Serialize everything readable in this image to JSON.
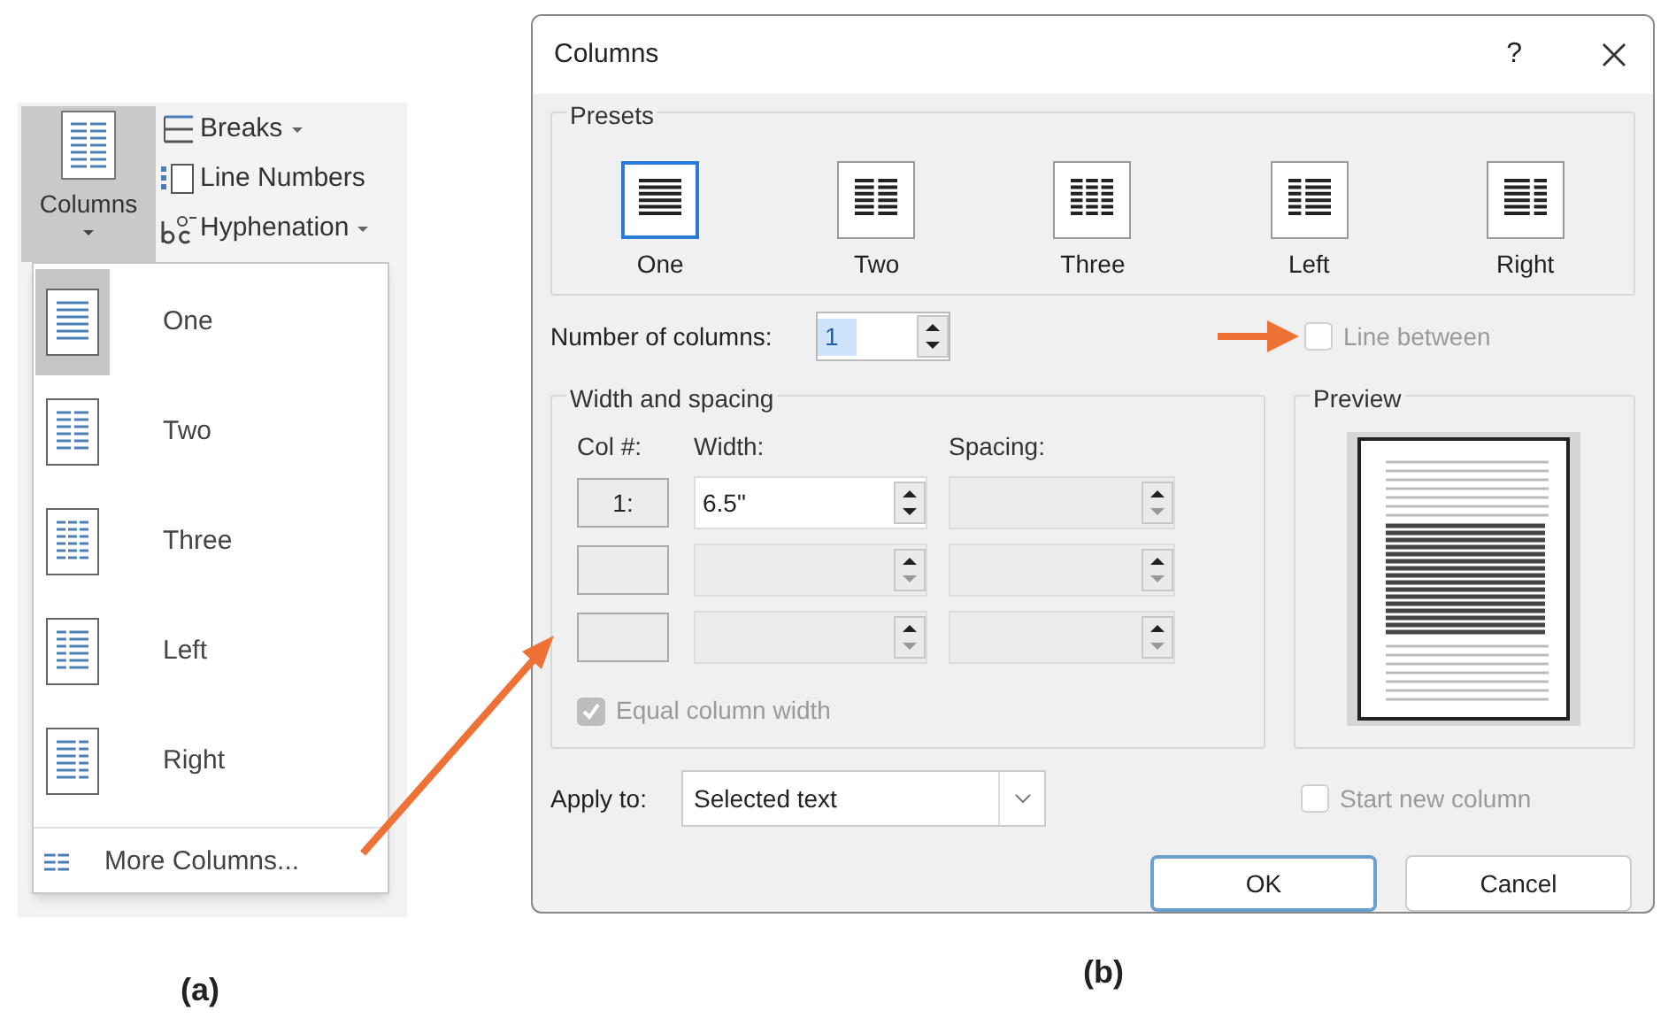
{
  "panel_a": {
    "ribbon": {
      "columns_button": "Columns",
      "commands": [
        {
          "label": "Breaks",
          "kind": "breaks",
          "dropdown": true
        },
        {
          "label": "Line Numbers",
          "kind": "line_numbers",
          "dropdown": false
        },
        {
          "label": "Hyphenation",
          "kind": "hyphenation",
          "dropdown": true
        }
      ]
    },
    "menu": {
      "items": [
        {
          "label": "One",
          "kind": "one",
          "selected": true
        },
        {
          "label": "Two",
          "kind": "two",
          "selected": false
        },
        {
          "label": "Three",
          "kind": "three",
          "selected": false
        },
        {
          "label": "Left",
          "kind": "left",
          "selected": false
        },
        {
          "label": "Right",
          "kind": "right",
          "selected": false
        }
      ],
      "more": "More Columns..."
    },
    "caption": "(a)"
  },
  "panel_b": {
    "dialog": {
      "title": "Columns",
      "help": "?",
      "presets": {
        "title": "Presets",
        "items": [
          {
            "label": "One",
            "kind": "one",
            "selected": true
          },
          {
            "label": "Two",
            "kind": "two",
            "selected": false
          },
          {
            "label": "Three",
            "kind": "three",
            "selected": false
          },
          {
            "label": "Left",
            "kind": "left",
            "selected": false
          },
          {
            "label": "Right",
            "kind": "right",
            "selected": false
          }
        ]
      },
      "number_of_columns": {
        "label": "Number of columns:",
        "value": "1"
      },
      "line_between": {
        "label": "Line between",
        "checked": false,
        "disabled": true
      },
      "width_and_spacing": {
        "title": "Width and spacing",
        "headers": [
          "Col #:",
          "Width:",
          "Spacing:"
        ],
        "rows": [
          {
            "col": "1:",
            "width": "6.5\"",
            "disabled": false
          },
          {
            "disabled": true
          },
          {
            "disabled": true
          }
        ]
      },
      "equal_column_width": {
        "label": "Equal column width",
        "checked": true,
        "disabled": true
      },
      "preview": {
        "title": "Preview"
      },
      "apply_to": {
        "label": "Apply to:",
        "value": "Selected text"
      },
      "start_new_column": {
        "label": "Start new column",
        "checked": false,
        "disabled": true
      },
      "buttons": [
        {
          "label": "OK",
          "default": true
        },
        {
          "label": "Cancel",
          "default": false
        }
      ]
    },
    "caption": "(b)"
  }
}
